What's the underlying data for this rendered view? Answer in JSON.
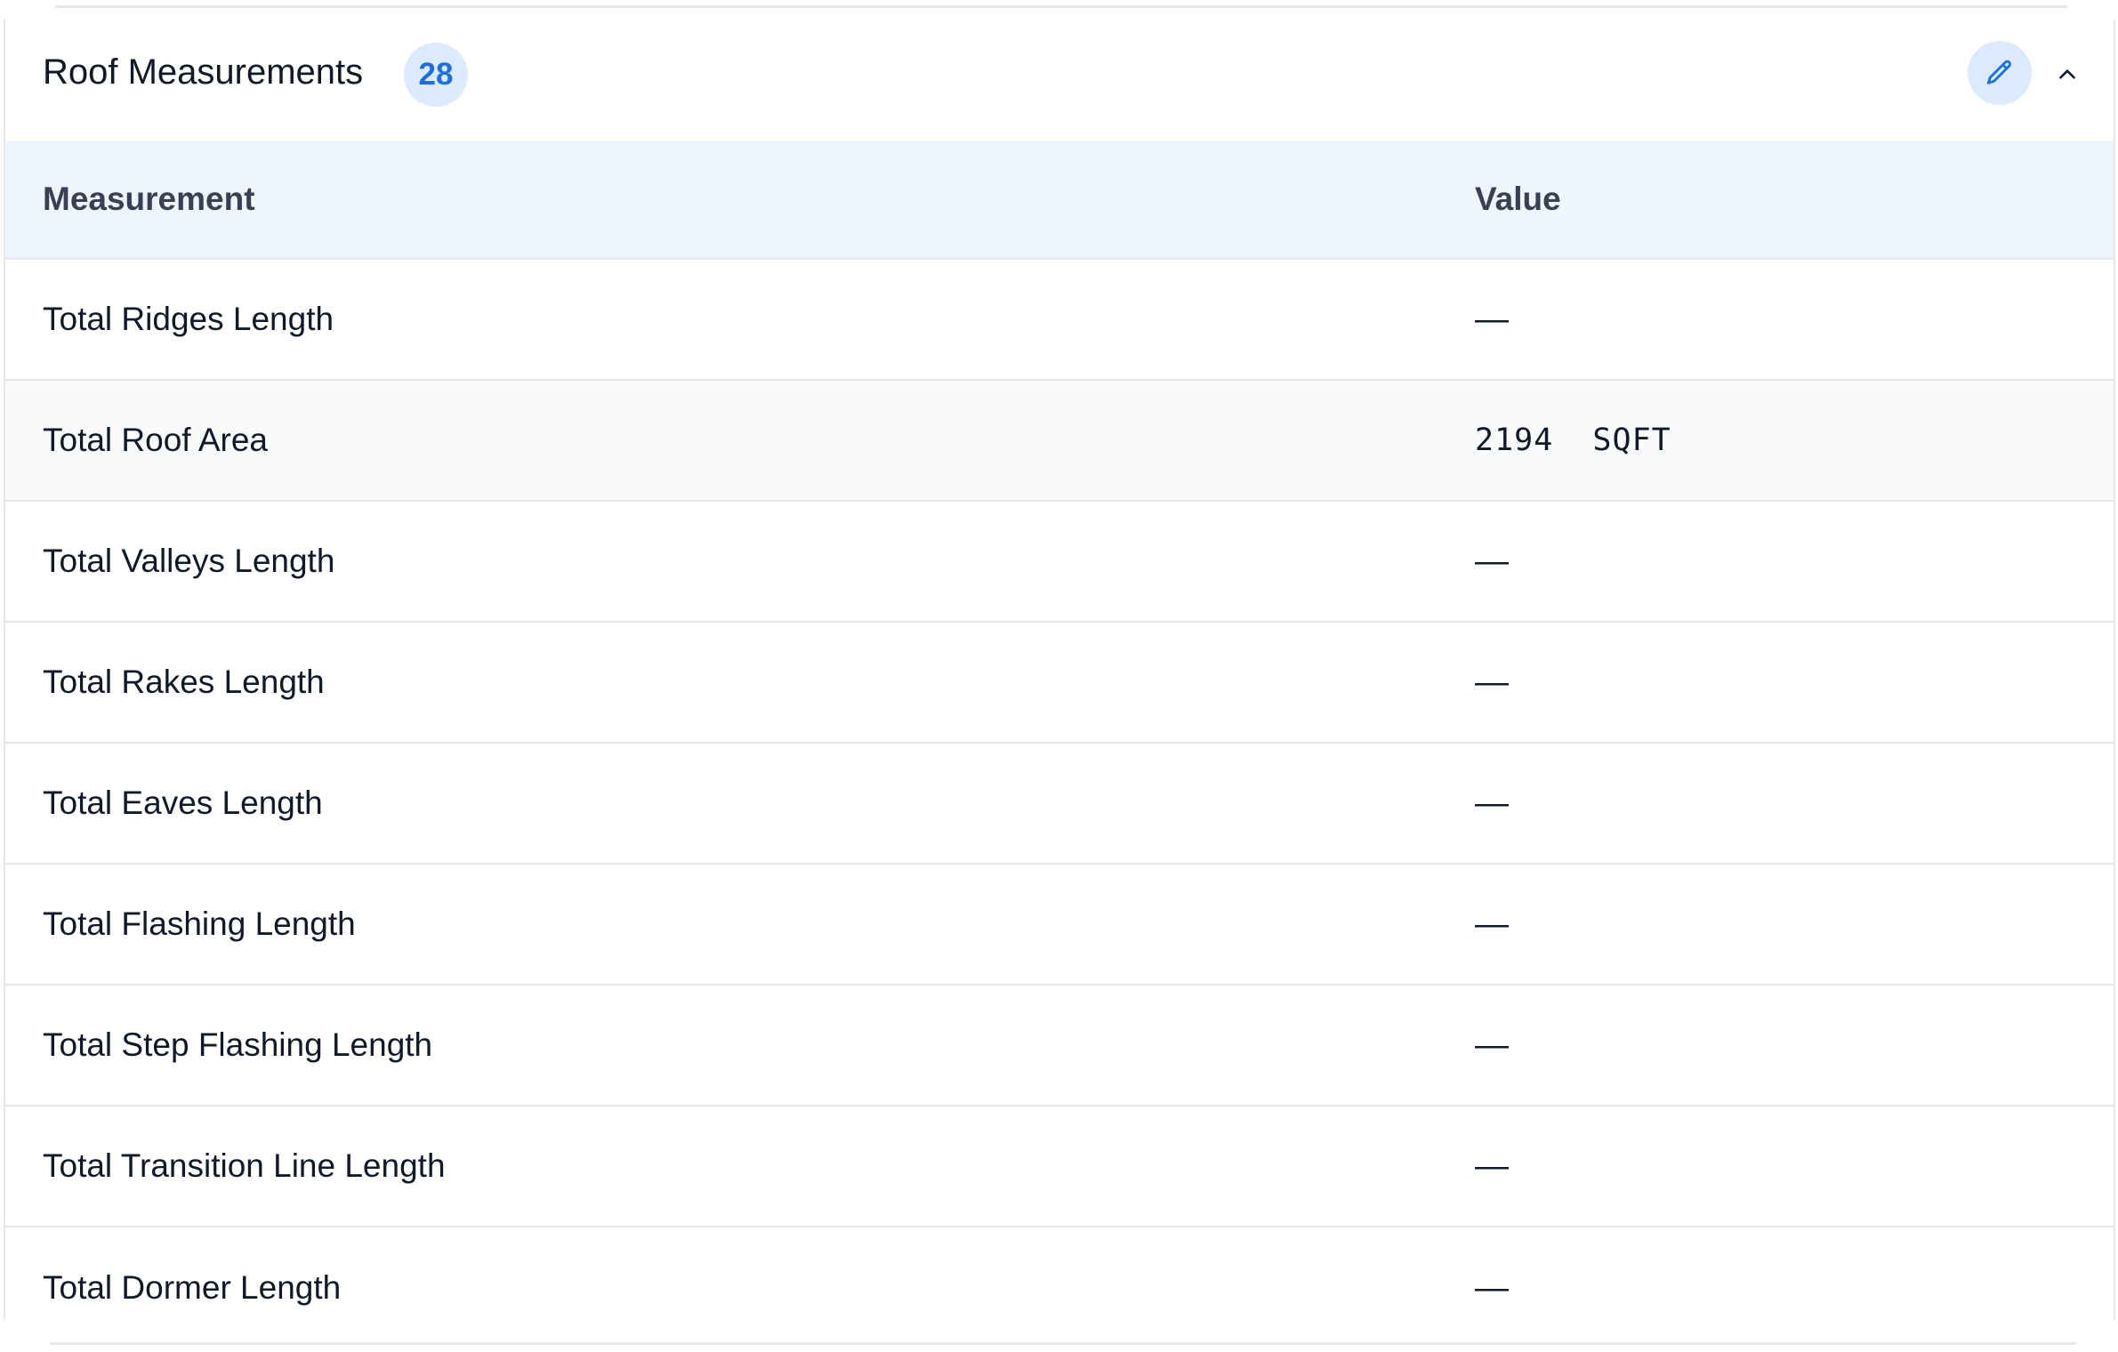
{
  "panel": {
    "title": "Roof Measurements",
    "count": "28",
    "edit_icon": "pencil-icon",
    "collapse_icon": "chevron-up-icon"
  },
  "table": {
    "columns": [
      "Measurement",
      "Value"
    ],
    "rows": [
      {
        "measurement": "Total Ridges Length",
        "value": "—"
      },
      {
        "measurement": "Total Roof Area",
        "value": "2194  SQFT"
      },
      {
        "measurement": "Total Valleys Length",
        "value": "—"
      },
      {
        "measurement": "Total Rakes Length",
        "value": "—"
      },
      {
        "measurement": "Total Eaves Length",
        "value": "—"
      },
      {
        "measurement": "Total Flashing Length",
        "value": "—"
      },
      {
        "measurement": "Total Step Flashing Length",
        "value": "—"
      },
      {
        "measurement": "Total Transition Line Length",
        "value": "—"
      },
      {
        "measurement": "Total Dormer Length",
        "value": "—"
      }
    ]
  },
  "colors": {
    "accent": "#1d6fe0",
    "badge_bg": "#dbeafe",
    "header_row_bg": "#eff5fc",
    "divider": "#e5e7eb"
  }
}
